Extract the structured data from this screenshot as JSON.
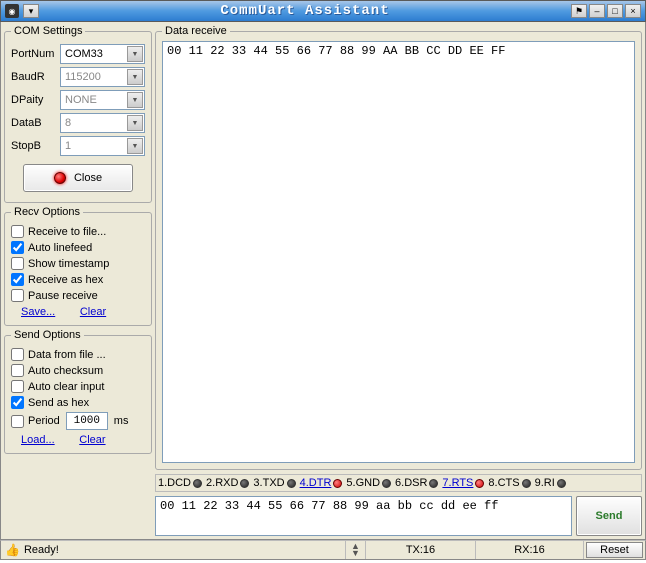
{
  "title": "CommUart Assistant",
  "com": {
    "legend": "COM Settings",
    "portnum_label": "PortNum",
    "portnum_value": "COM33",
    "baudr_label": "BaudR",
    "baudr_value": "115200",
    "dparity_label": "DPaity",
    "dparity_value": "NONE",
    "datab_label": "DataB",
    "datab_value": "8",
    "stopb_label": "StopB",
    "stopb_value": "1",
    "close_label": "Close"
  },
  "recv": {
    "legend": "Recv Options",
    "to_file": "Receive to file...",
    "auto_lf": "Auto linefeed",
    "show_ts": "Show timestamp",
    "as_hex": "Receive as hex",
    "pause": "Pause receive",
    "save": "Save...",
    "clear": "Clear"
  },
  "send": {
    "legend": "Send Options",
    "data_from_file": "Data from file ...",
    "auto_checksum": "Auto checksum",
    "auto_clear": "Auto clear input",
    "as_hex": "Send as hex",
    "period_label": "Period",
    "period_value": "1000",
    "period_unit": "ms",
    "load": "Load...",
    "clear": "Clear"
  },
  "data_receive": {
    "legend": "Data receive",
    "content": "00 11 22 33 44 55 66 77 88 99 AA BB CC DD EE FF "
  },
  "signals": {
    "dcd": "1.DCD",
    "rxd": "2.RXD",
    "txd": "3.TXD",
    "dtr": "4.DTR",
    "gnd": "5.GND",
    "dsr": "6.DSR",
    "rts": "7.RTS",
    "cts": "8.CTS",
    "ri": "9.RI"
  },
  "send_area": {
    "text": "00 11 22 33 44 55 66 77 88 99 aa bb cc dd ee ff ",
    "button": "Send"
  },
  "status": {
    "ready": "Ready!",
    "tx": "TX:16",
    "rx": "RX:16",
    "reset": "Reset"
  }
}
